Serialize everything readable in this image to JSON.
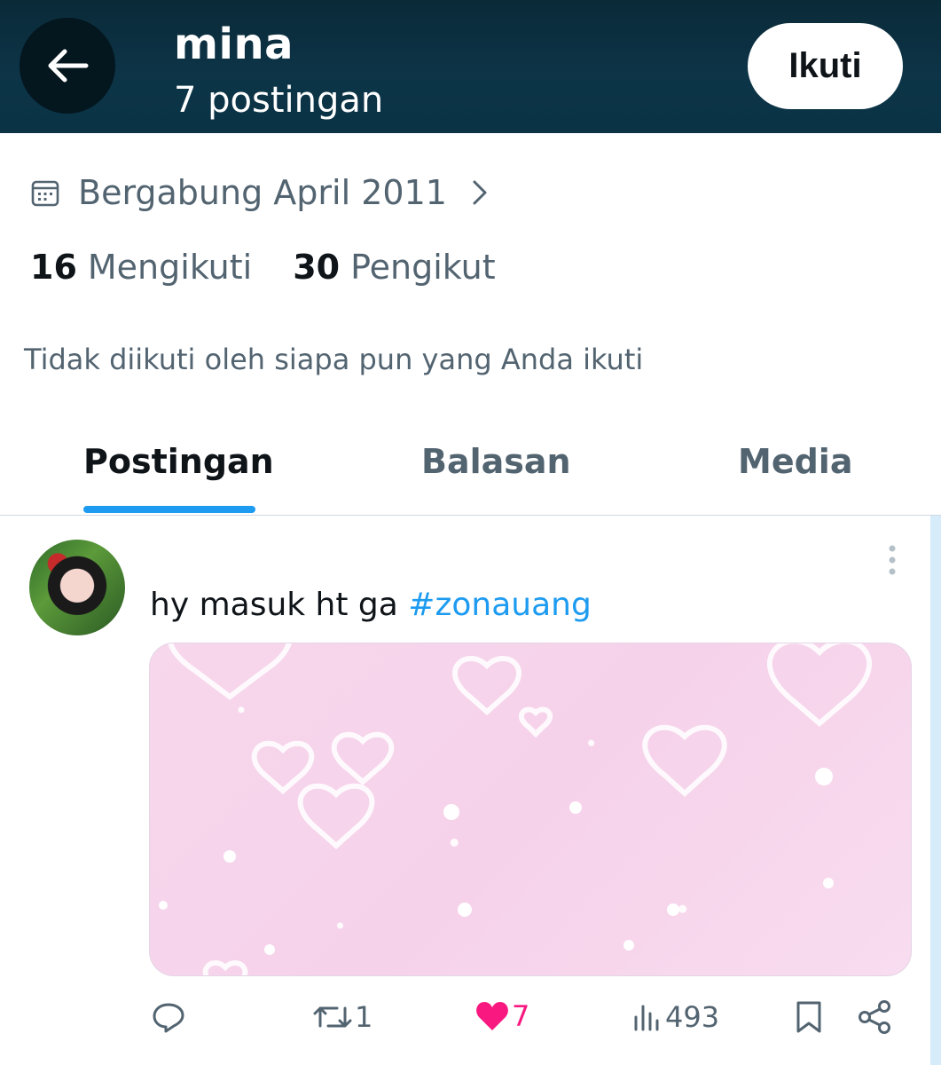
{
  "header": {
    "name": "mina",
    "post_count": "7 postingan",
    "follow_label": "Ikuti"
  },
  "profile": {
    "joined": "Bergabung April 2011",
    "following_count": "16",
    "following_label": "Mengikuti",
    "followers_count": "30",
    "followers_label": "Pengikut",
    "not_followed_text": "Tidak diikuti oleh siapa pun yang Anda ikuti"
  },
  "tabs": [
    {
      "label": "Postingan",
      "active": true
    },
    {
      "label": "Balasan",
      "active": false
    },
    {
      "label": "Media",
      "active": false
    }
  ],
  "post": {
    "text": "hy masuk ht ga ",
    "hashtag": "#zonauang",
    "actions": {
      "reply_count": "",
      "repost_count": "1",
      "like_count": "7",
      "views_count": "493"
    }
  },
  "colors": {
    "header_bg": "#0d3447",
    "accent": "#1d9bf0",
    "like": "#f91880",
    "muted": "#536471"
  }
}
